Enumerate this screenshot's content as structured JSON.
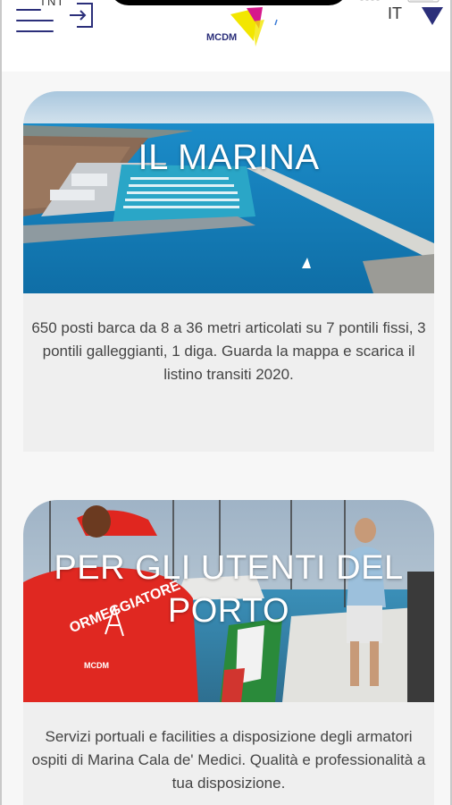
{
  "header": {
    "status_text": "TNT",
    "logo_text": "MCDM",
    "language": "IT"
  },
  "cards": [
    {
      "title": "IL MARINA",
      "description": "650 posti barca da 8 a 36 metri articolati su 7 pontili fissi, 3 pontili galleggianti, 1 diga. Guarda la mappa e scarica il listino transiti 2020."
    },
    {
      "title": "PER GLI UTENTI DEL PORTO",
      "description": "Servizi portuali e facilities a disposizione degli armatori ospiti di Marina Cala de' Medici. Qualità e professionalità a tua disposizione.",
      "shirt_text": "ORMEGGIATORE",
      "shirt_logo": "MCDM"
    }
  ],
  "colors": {
    "brand_navy": "#2b2f7a",
    "brand_yellow": "#f2e600",
    "brand_magenta": "#d6198b",
    "card_background": "#efefef"
  },
  "icons": {
    "menu": "hamburger-menu-icon",
    "login": "login-arrow-icon",
    "language_dropdown": "triangle-down-icon"
  }
}
